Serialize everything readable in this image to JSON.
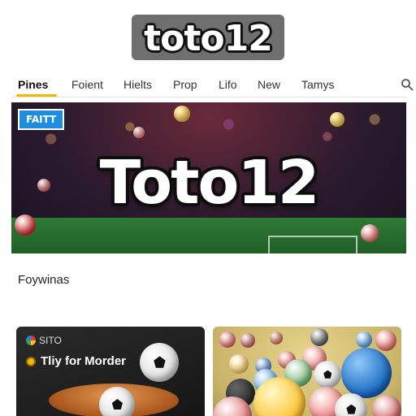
{
  "logo": {
    "text": "toto12"
  },
  "nav": {
    "items": [
      {
        "label": "Pines",
        "active": true
      },
      {
        "label": "Foient",
        "active": false
      },
      {
        "label": "Hielts",
        "active": false
      },
      {
        "label": "Prop",
        "active": false
      },
      {
        "label": "Lifo",
        "active": false
      },
      {
        "label": "New",
        "active": false
      },
      {
        "label": "Tamys",
        "active": false
      }
    ],
    "search_icon": "search-icon",
    "accent_color": "#f2b705"
  },
  "hero": {
    "badge": "FAITT",
    "title": "Toto12"
  },
  "section": {
    "title": "Foywinas"
  },
  "cards": [
    {
      "meta": "SITO",
      "title": "Tliy for Morder"
    },
    {
      "meta": "",
      "title": ""
    }
  ]
}
